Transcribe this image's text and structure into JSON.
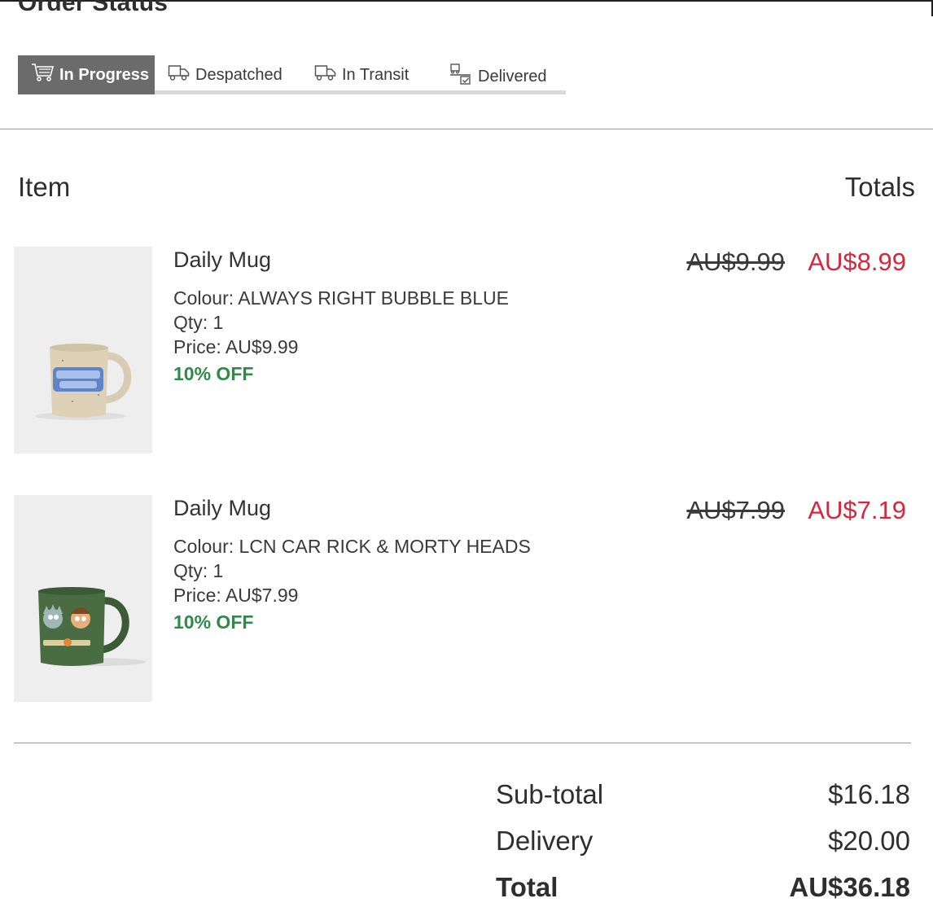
{
  "page": {
    "title": "Order Status"
  },
  "status_tabs": [
    {
      "label": "In Progress",
      "icon": "cart-icon",
      "active": true
    },
    {
      "label": "Despatched",
      "icon": "truck-icon",
      "active": false
    },
    {
      "label": "In Transit",
      "icon": "truck-icon",
      "active": false
    },
    {
      "label": "Delivered",
      "icon": "delivered-box-icon",
      "active": false
    }
  ],
  "table": {
    "item_header": "Item",
    "totals_header": "Totals"
  },
  "items": [
    {
      "name": "Daily Mug",
      "colour": "Colour: ALWAYS RIGHT BUBBLE BLUE",
      "qty": "Qty: 1",
      "price": "Price: AU$9.99",
      "discount": "10% OFF",
      "original_total": "AU$9.99",
      "sale_total": "AU$8.99",
      "image_text": "ALWAYS RIGHT"
    },
    {
      "name": "Daily Mug",
      "colour": "Colour: LCN CAR RICK & MORTY HEADS",
      "qty": "Qty: 1",
      "price": "Price: AU$7.99",
      "discount": "10% OFF",
      "original_total": "AU$7.99",
      "sale_total": "AU$7.19",
      "image_text": "RICK & MORTY"
    }
  ],
  "summary": {
    "subtotal_label": "Sub-total",
    "subtotal_value": "$16.18",
    "delivery_label": "Delivery",
    "delivery_value": "$20.00",
    "total_label": "Total",
    "total_value": "AU$36.18"
  },
  "colors": {
    "active_tab_bg": "#6b6b6b",
    "sale_price": "#d7263d",
    "discount_text": "#2f8a4a"
  }
}
